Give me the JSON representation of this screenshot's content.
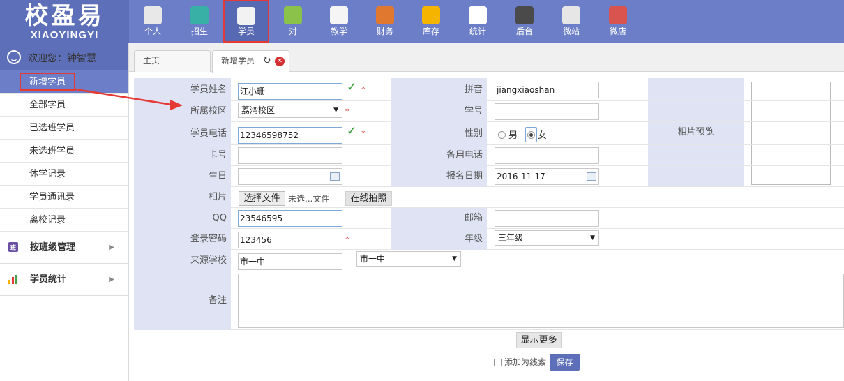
{
  "logo": {
    "cn": "校盈易",
    "en": "XIAOYINGYI"
  },
  "nav": [
    {
      "label": "个人",
      "icon": "user-icon",
      "color": "#e8e8e8"
    },
    {
      "label": "招生",
      "icon": "search-person-icon",
      "color": "#39b0a6"
    },
    {
      "label": "学员",
      "icon": "student-card-icon",
      "color": "#f2f2f2",
      "active": true
    },
    {
      "label": "一对一",
      "icon": "chat-icon",
      "color": "#8bc34a"
    },
    {
      "label": "教学",
      "icon": "notebook-icon",
      "color": "#f5f5f5"
    },
    {
      "label": "财务",
      "icon": "briefcase-icon",
      "color": "#e0792f"
    },
    {
      "label": "库存",
      "icon": "pie-chart-icon",
      "color": "#f4b400"
    },
    {
      "label": "统计",
      "icon": "bar-chart-icon",
      "color": "#ffffff"
    },
    {
      "label": "后台",
      "icon": "monitor-icon",
      "color": "#4a4a4a"
    },
    {
      "label": "微站",
      "icon": "web-page-icon",
      "color": "#e6e6e6"
    },
    {
      "label": "微店",
      "icon": "shop-icon",
      "color": "#d9534f"
    }
  ],
  "sidebar": {
    "welcome": "欢迎您：钟智慧",
    "items": [
      "新增学员",
      "全部学员",
      "已选班学员",
      "未选班学员",
      "休学记录",
      "学员通讯录",
      "离校记录"
    ],
    "groups": [
      {
        "label": "按班级管理",
        "icon": "class-icon"
      },
      {
        "label": "学员统计",
        "icon": "stats-icon"
      }
    ]
  },
  "tabs": {
    "home": "主页",
    "current": "新增学员"
  },
  "form": {
    "name_label": "学员姓名",
    "name_value": "江小珊",
    "pinyin_label": "拼音",
    "pinyin_value": "jiangxiaoshan",
    "campus_label": "所属校区",
    "campus_value": "荔湾校区",
    "student_no_label": "学号",
    "student_no_value": "",
    "phone_label": "学员电话",
    "phone_value": "12346598752",
    "gender_label": "性别",
    "gender_male": "男",
    "gender_female": "女",
    "gender_selected": "女",
    "card_label": "卡号",
    "card_value": "",
    "alt_phone_label": "备用电话",
    "alt_phone_value": "",
    "birthday_label": "生日",
    "birthday_value": "",
    "enroll_date_label": "报名日期",
    "enroll_date_value": "2016-11-17",
    "photo_label": "相片",
    "choose_file": "选择文件",
    "no_file": "未选...文件",
    "online_photo": "在线拍照",
    "photo_preview_label": "相片预览",
    "qq_label": "QQ",
    "qq_value": "23546595",
    "email_label": "邮箱",
    "email_value": "",
    "password_label": "登录密码",
    "password_value": "123456",
    "grade_label": "年级",
    "grade_value": "三年级",
    "school_label": "来源学校",
    "school_value": "市一中",
    "school_select": "市一中",
    "remark_label": "备注",
    "remark_value": "",
    "show_more": "显示更多",
    "add_as_lead": "添加为线索",
    "save": "保存"
  }
}
